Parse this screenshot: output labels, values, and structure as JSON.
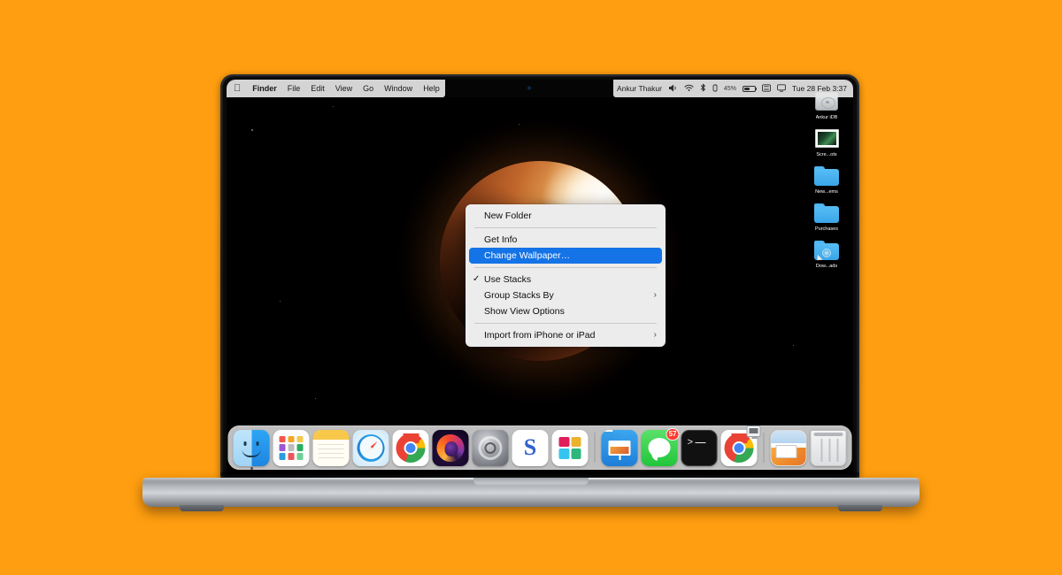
{
  "page": {
    "background_color": "#ff9e10",
    "device": "MacBook Pro"
  },
  "menubar": {
    "apple_logo": "apple-logo",
    "items": [
      {
        "label": "Finder",
        "bold": true
      },
      {
        "label": "File",
        "bold": false
      },
      {
        "label": "Edit",
        "bold": false
      },
      {
        "label": "View",
        "bold": false
      },
      {
        "label": "Go",
        "bold": false
      },
      {
        "label": "Window",
        "bold": false
      },
      {
        "label": "Help",
        "bold": false
      }
    ],
    "status": {
      "user_name": "Ankur Thakur",
      "volume_icon": "volume-icon",
      "wifi_icon": "wifi-icon",
      "bluetooth_icon": "bluetooth-icon",
      "battery_percent": "45%",
      "control_center_icon": "control-center-icon",
      "screen_mirroring_icon": "screen-mirroring-icon",
      "clock": "Tue 28 Feb  3:37"
    }
  },
  "desktop": {
    "icons": [
      {
        "label": "Ankur iDB",
        "type": "hard-drive"
      },
      {
        "label": "Scre...ots",
        "type": "screenshot"
      },
      {
        "label": "New...ems",
        "type": "folder"
      },
      {
        "label": "Purchases",
        "type": "folder"
      },
      {
        "label": "Dow...ads",
        "type": "folder-disc"
      }
    ],
    "wallpaper": "lunar-eclipse"
  },
  "context_menu": {
    "highlight_color": "#1473e6",
    "items": [
      {
        "label": "New Folder",
        "type": "item"
      },
      {
        "type": "separator"
      },
      {
        "label": "Get Info",
        "type": "item"
      },
      {
        "label": "Change Wallpaper…",
        "type": "item",
        "selected": true
      },
      {
        "type": "separator"
      },
      {
        "label": "Use Stacks",
        "type": "item",
        "checked": true,
        "check_glyph": "✓"
      },
      {
        "label": "Group Stacks By",
        "type": "item",
        "submenu": true,
        "submenu_glyph": "›"
      },
      {
        "label": "Show View Options",
        "type": "item"
      },
      {
        "type": "separator"
      },
      {
        "label": "Import from iPhone or iPad",
        "type": "item",
        "submenu": true,
        "submenu_glyph": "›"
      }
    ]
  },
  "dock": {
    "items": [
      {
        "name": "Finder",
        "running": true
      },
      {
        "name": "Launchpad",
        "running": false
      },
      {
        "name": "Notes",
        "running": false
      },
      {
        "name": "Safari",
        "running": false
      },
      {
        "name": "Google Chrome",
        "running": false
      },
      {
        "name": "Firefox",
        "running": false
      },
      {
        "name": "System Settings",
        "running": false
      },
      {
        "name": "Simplenote",
        "running": false
      },
      {
        "name": "Slack",
        "running": false
      },
      {
        "separator": true
      },
      {
        "name": "Keynote",
        "running": false
      },
      {
        "name": "Messages",
        "running": false,
        "badge": "57"
      },
      {
        "name": "Terminal",
        "running": false
      },
      {
        "name": "Google Chrome",
        "running": false,
        "screen_share": true
      },
      {
        "separator": true
      },
      {
        "name": "Document",
        "running": false
      },
      {
        "name": "Trash",
        "running": false
      }
    ],
    "terminal_prompt": ">_",
    "simplenote_glyph": "S"
  }
}
